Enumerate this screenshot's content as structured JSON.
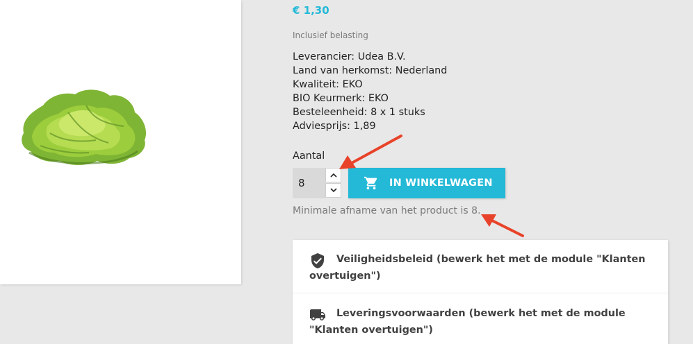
{
  "product": {
    "price": "€ 1,30",
    "tax_note": "Inclusief belasting",
    "image_icon": "lettuce-image"
  },
  "details": [
    "Leverancier: Udea B.V.",
    "Land van herkomst: Nederland",
    "Kwaliteit: EKO",
    "BIO Keurmerk: EKO",
    "Besteleenheid: 8 x 1 stuks",
    "Adviesprijs: 1,89"
  ],
  "quantity": {
    "label": "Aantal",
    "value": "8",
    "up_icon": "chevron-up-icon",
    "down_icon": "chevron-down-icon"
  },
  "cart": {
    "label": "IN WINKELWAGEN",
    "icon": "cart-icon"
  },
  "minimum_note": "Minimale afname van het product is 8.",
  "reassurance": [
    {
      "icon": "shield-check-icon",
      "text": "Veiligheidsbeleid (bewerk het met de module \"Klanten overtuigen\")"
    },
    {
      "icon": "truck-icon",
      "text": "Leveringsvoorwaarden (bewerk het met de module \"Klanten overtuigen\")"
    }
  ],
  "colors": {
    "accent": "#24b9d7",
    "background": "#e8e8e8",
    "annotation_arrow": "#e8432a"
  }
}
